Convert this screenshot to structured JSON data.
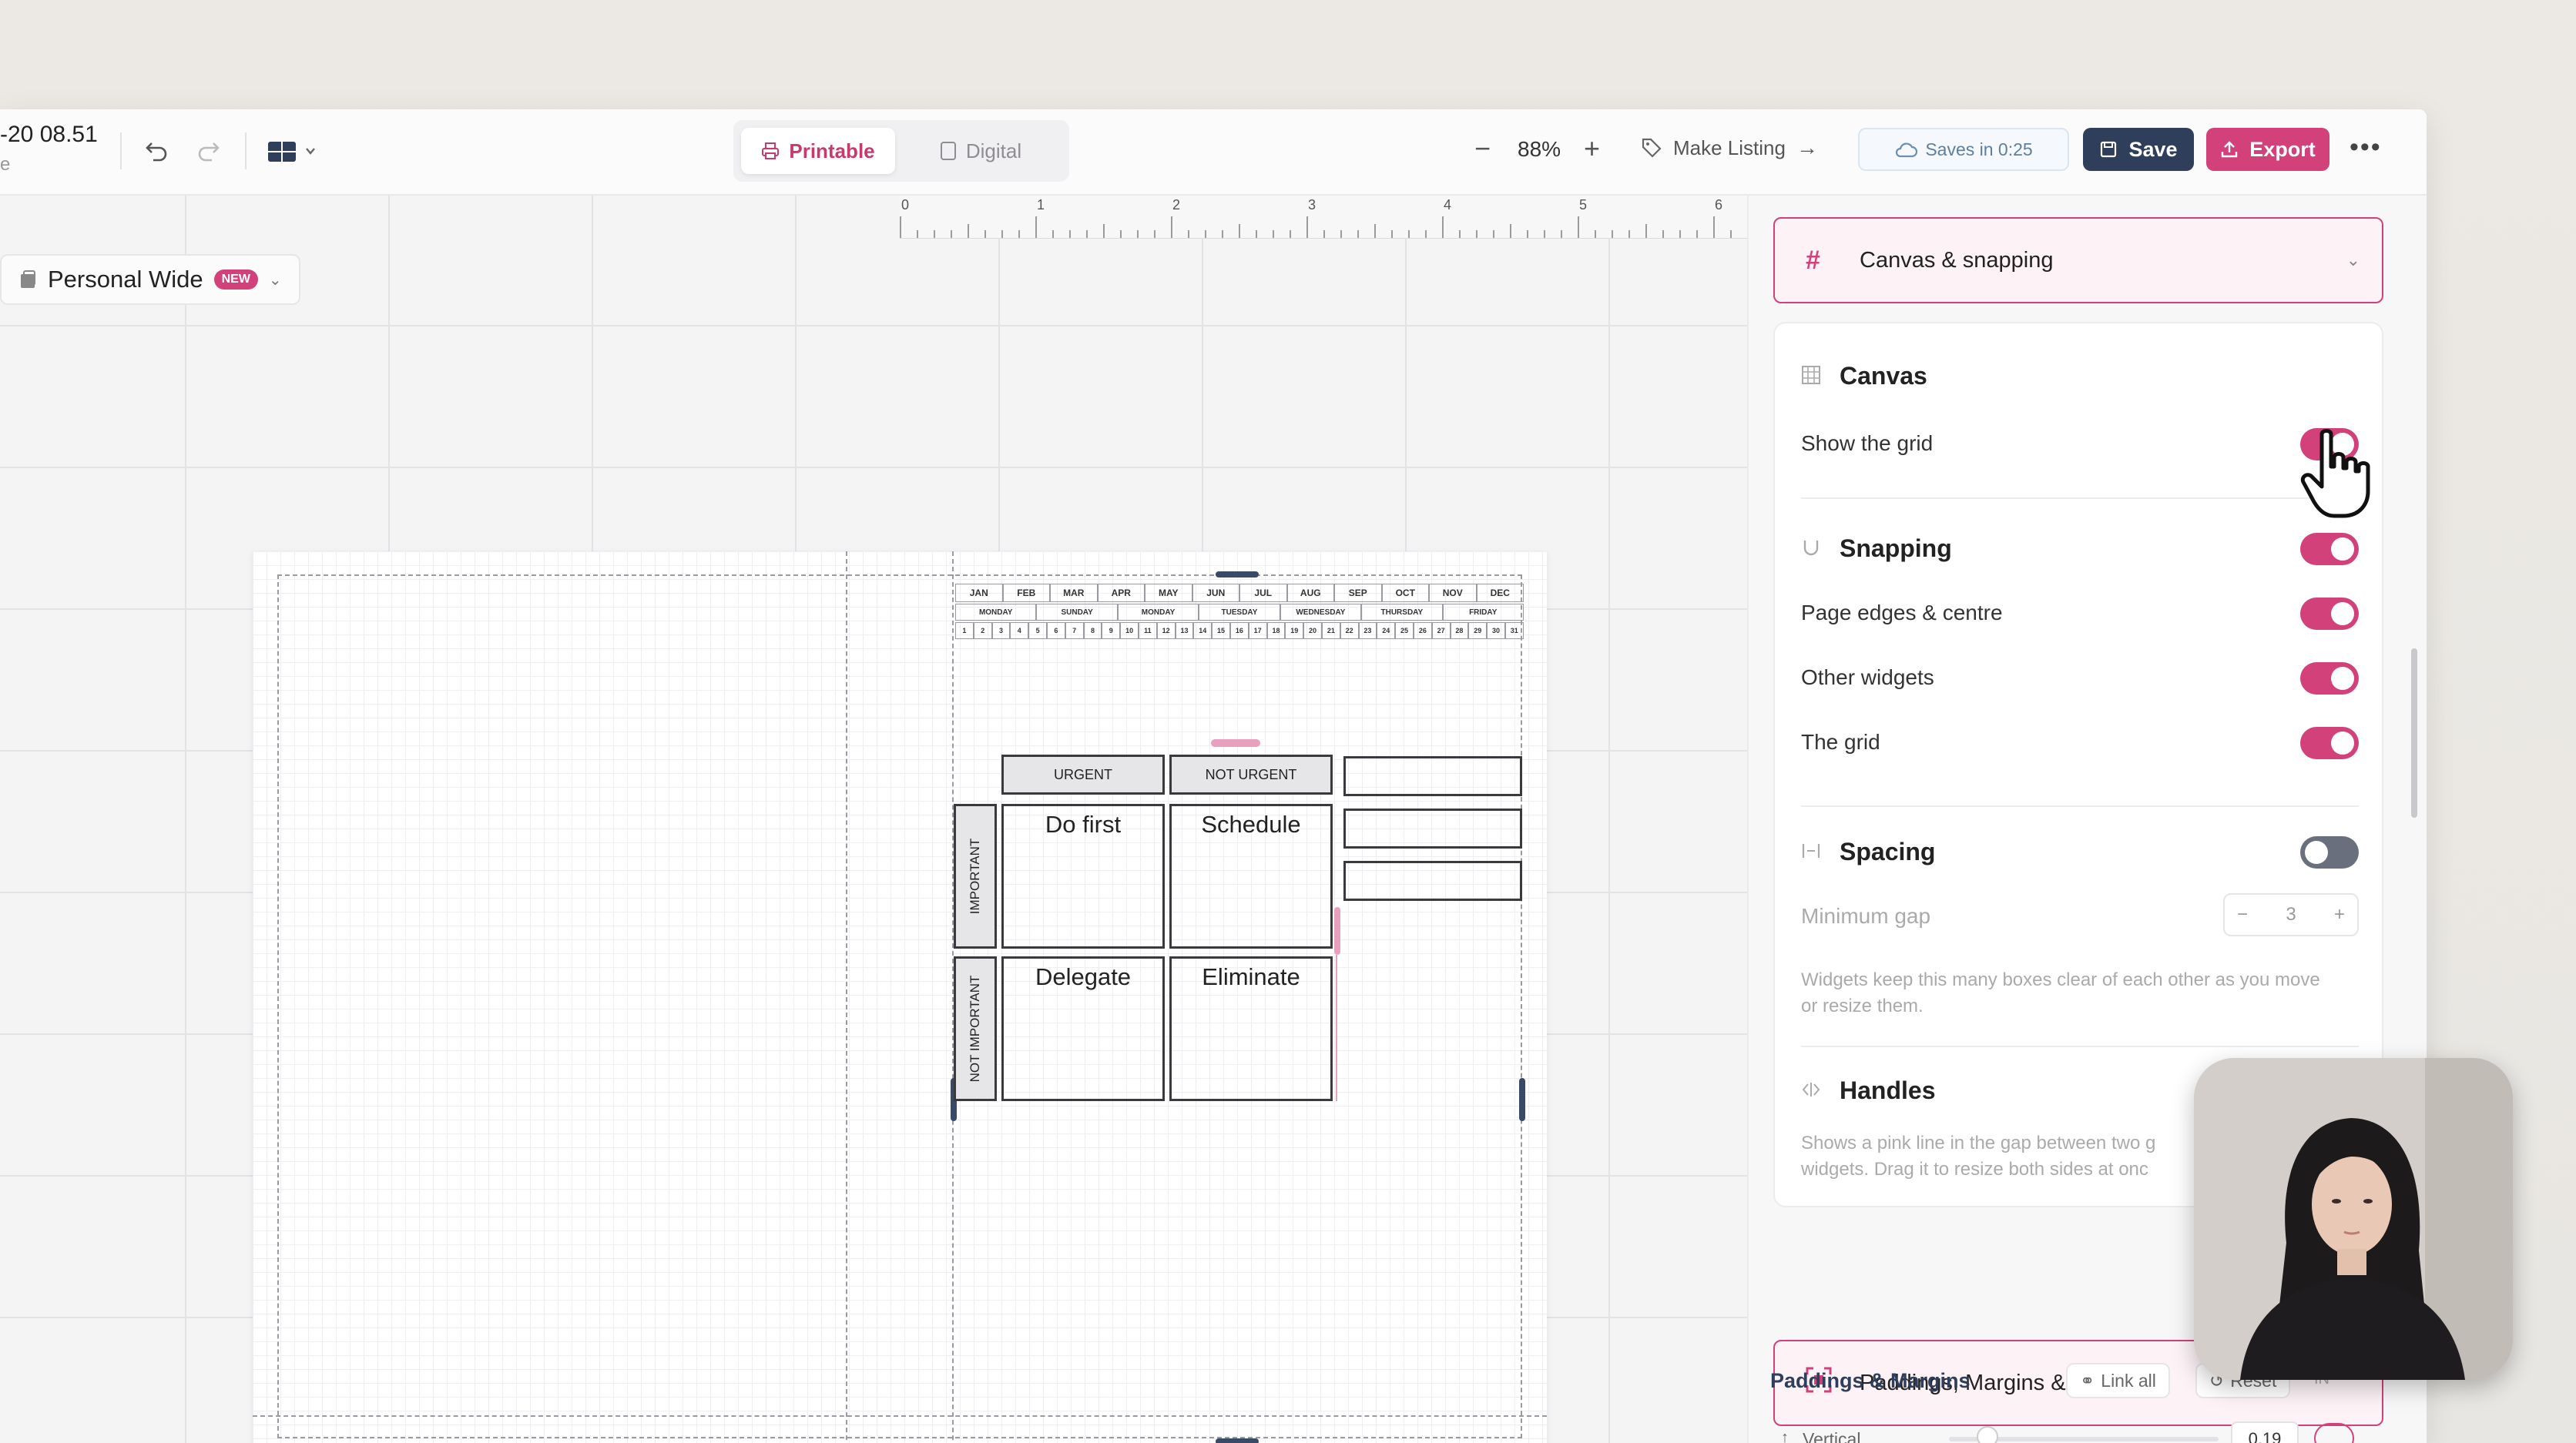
{
  "doc": {
    "title": "-20 08.51",
    "subtitle": "e"
  },
  "toolbar": {
    "mode_printable": "Printable",
    "mode_digital": "Digital",
    "zoom_value": "88%",
    "zoom_minus": "−",
    "zoom_plus": "+",
    "make_listing": "Make Listing",
    "saves_in": "Saves in 0:25",
    "save_label": "Save",
    "export_label": "Export",
    "more": "•••"
  },
  "canvas": {
    "layout_name": "Personal Wide",
    "badge": "NEW",
    "ruler_numbers": [
      "0",
      "1",
      "2",
      "3",
      "4",
      "5",
      "6"
    ]
  },
  "planner": {
    "months": [
      "JAN",
      "FEB",
      "MAR",
      "APR",
      "MAY",
      "JUN",
      "JUL",
      "AUG",
      "SEP",
      "OCT",
      "NOV",
      "DEC"
    ],
    "weekdays": [
      "MONDAY",
      "SUNDAY",
      "MONDAY",
      "TUESDAY",
      "WEDNESDAY",
      "THURSDAY",
      "FRIDAY"
    ],
    "days": [
      "1",
      "2",
      "3",
      "4",
      "5",
      "6",
      "7",
      "8",
      "9",
      "10",
      "11",
      "12",
      "13",
      "14",
      "15",
      "16",
      "17",
      "18",
      "19",
      "20",
      "21",
      "22",
      "23",
      "24",
      "25",
      "26",
      "27",
      "28",
      "29",
      "30",
      "31"
    ],
    "urgent": "URGENT",
    "not_urgent": "NOT URGENT",
    "important": "IMPORTANT",
    "not_important": "NOT IMPORTANT",
    "do_first": "Do first",
    "schedule": "Schedule",
    "delegate": "Delegate",
    "eliminate": "Eliminate"
  },
  "panel": {
    "section_canvas": "Canvas & snapping",
    "canvas_title": "Canvas",
    "show_grid": "Show the grid",
    "snapping_title": "Snapping",
    "page_edges": "Page edges & centre",
    "other_widgets": "Other widgets",
    "the_grid": "The grid",
    "spacing_title": "Spacing",
    "minimum_gap": "Minimum gap",
    "min_gap_value": "3",
    "spacing_help": "Widgets keep this many boxes clear of each other as you move or resize them.",
    "handles_title": "Handles",
    "handles_help_1": "Shows a pink line in the gap between two g",
    "handles_help_2": "widgets. Drag it to resize both sides at onc",
    "section_paddings": "Paddings, Margins & Gaps",
    "pm_title": "Paddings & Margins",
    "link_all": "Link all",
    "reset": "Reset",
    "unit": "IN",
    "vertical": "Vertical",
    "vertical_value": "0.19"
  },
  "toggles": {
    "show_grid": true,
    "snapping": true,
    "page_edges": true,
    "other_widgets": true,
    "the_grid": true,
    "spacing": false
  },
  "colors": {
    "accent": "#d2417a",
    "navy": "#2f3e5a"
  }
}
